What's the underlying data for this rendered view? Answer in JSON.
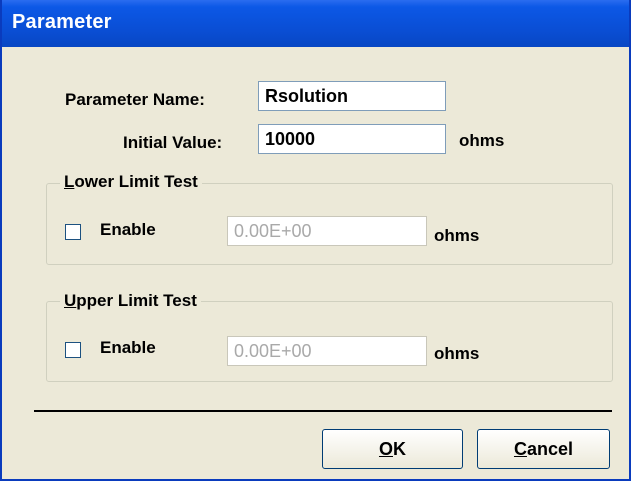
{
  "window": {
    "title": "Parameter"
  },
  "fields": {
    "name_label": "Parameter Name:",
    "name_value": "Rsolution",
    "initial_label": "Initial Value:",
    "initial_value": "10000",
    "initial_unit": "ohms"
  },
  "lower": {
    "legend_first": "L",
    "legend_rest": "ower Limit Test",
    "enable_label": "Enable",
    "enabled": false,
    "value": "0.00E+00",
    "unit": "ohms"
  },
  "upper": {
    "legend_first": "U",
    "legend_rest": "pper Limit Test",
    "enable_label": "Enable",
    "enabled": false,
    "value": "0.00E+00",
    "unit": "ohms"
  },
  "buttons": {
    "ok_first": "O",
    "ok_rest": "K",
    "cancel_first": "C",
    "cancel_rest": "ancel"
  },
  "colors": {
    "titlebar": "#0a4fd6",
    "dialog_bg": "#ece9d8"
  }
}
